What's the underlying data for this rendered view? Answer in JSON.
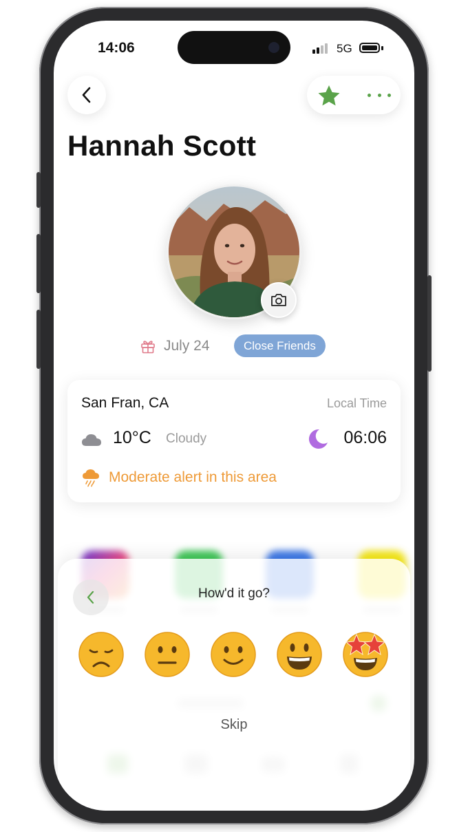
{
  "status_bar": {
    "time": "14:06",
    "network": "5G"
  },
  "profile": {
    "name": "Hannah Scott",
    "birthday": "July 24",
    "tag": "Close Friends"
  },
  "location_card": {
    "city": "San Fran, CA",
    "local_time_label": "Local Time",
    "temperature": "10°C",
    "condition": "Cloudy",
    "local_time": "06:06",
    "alert": "Moderate alert in this area"
  },
  "feedback_sheet": {
    "title": "How'd it go?",
    "options": [
      "very-sad",
      "neutral",
      "slightly-happy",
      "happy",
      "star-struck"
    ],
    "skip_label": "Skip"
  },
  "colors": {
    "accent_green": "#5aa34a",
    "tag_blue": "#7fa5d6",
    "alert_orange": "#ee9a37",
    "moon_purple": "#b06be0"
  }
}
